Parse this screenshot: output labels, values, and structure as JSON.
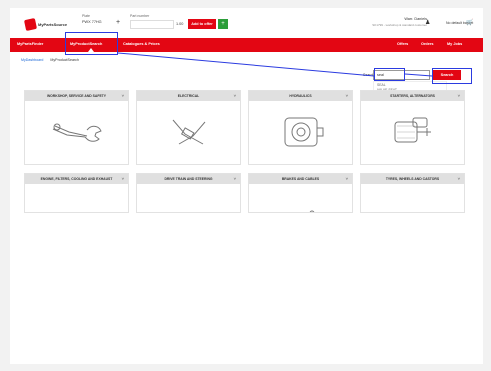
{
  "header": {
    "logo_text": "MyPartsSource",
    "plate_label": "Plate",
    "plate_value": "PWX 77HG",
    "part_label": "Part number",
    "qty_value": "1.00",
    "add_label": "Add to offer",
    "account_name": "Warr. Daniels",
    "account_sub": "SK1799 - workshop & standard customer",
    "basket_label": "No default basket"
  },
  "nav": {
    "items": [
      "MyPartsFinder",
      "MyProductSearch",
      "Catalogues & Prices"
    ],
    "right_items": [
      "Offers",
      "Orders",
      "My Jobs"
    ]
  },
  "breadcrumb": {
    "home": "MyDashboard",
    "current": "MyProductSearch"
  },
  "search": {
    "label": "Search",
    "value": "seal",
    "button_label": "Search",
    "suggestions": [
      "SEAL",
      "VALVE SEAT"
    ]
  },
  "categories": [
    "WORKSHOP, SERVICE AND SAFETY",
    "ELECTRICAL",
    "HYDRAULICS",
    "STARTERS, ALTERNATORS",
    "ENGINE, FILTERS, COOLING AND EXHAUST",
    "DRIVE TRAIN AND STEERING",
    "BRAKES AND CABLES",
    "TYRES, WHEELS AND CASTORS"
  ],
  "colors": {
    "brand_red": "#e30613",
    "accent_green": "#2c9e3a",
    "annotation_blue": "#2b3be0",
    "link_blue": "#1a66d6"
  },
  "icons": [
    "logo-icon",
    "plus-icon",
    "user-icon",
    "caret-down-icon",
    "cart-icon",
    "plus-square-icon"
  ]
}
